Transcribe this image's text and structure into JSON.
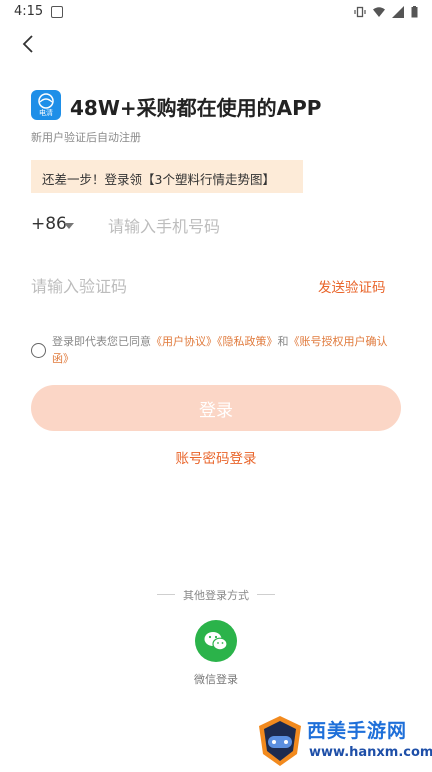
{
  "status_bar": {
    "time": "4:15"
  },
  "header": {
    "back_icon": "back-arrow-icon"
  },
  "brand": {
    "logo_text": "电清",
    "headline": "48W+采购都在使用的APP",
    "subtext": "新用户验证后自动注册"
  },
  "promo": {
    "text": "还差一步！登录领【3个塑料行情走势图】"
  },
  "phone": {
    "country_code": "+86",
    "placeholder": "请输入手机号码"
  },
  "code": {
    "placeholder": "请输入验证码",
    "send_label": "发送验证码"
  },
  "agreement": {
    "prefix": "登录即代表您已同意",
    "user_agreement": "《用户协议》",
    "privacy_policy": "《隐私政策》",
    "and": "和",
    "authorization": "《账号授权用户确认函》"
  },
  "login_button": "登录",
  "password_login": "账号密码登录",
  "other_login": {
    "title": "其他登录方式",
    "wechat_label": "微信登录"
  },
  "watermark": {
    "title": "西美手游网",
    "url": "www.hanxm.com"
  },
  "colors": {
    "accent": "#e9652b",
    "button_disabled": "#fbd6c6",
    "promo_bg": "#fdebd8",
    "wechat": "#2bb34a"
  }
}
